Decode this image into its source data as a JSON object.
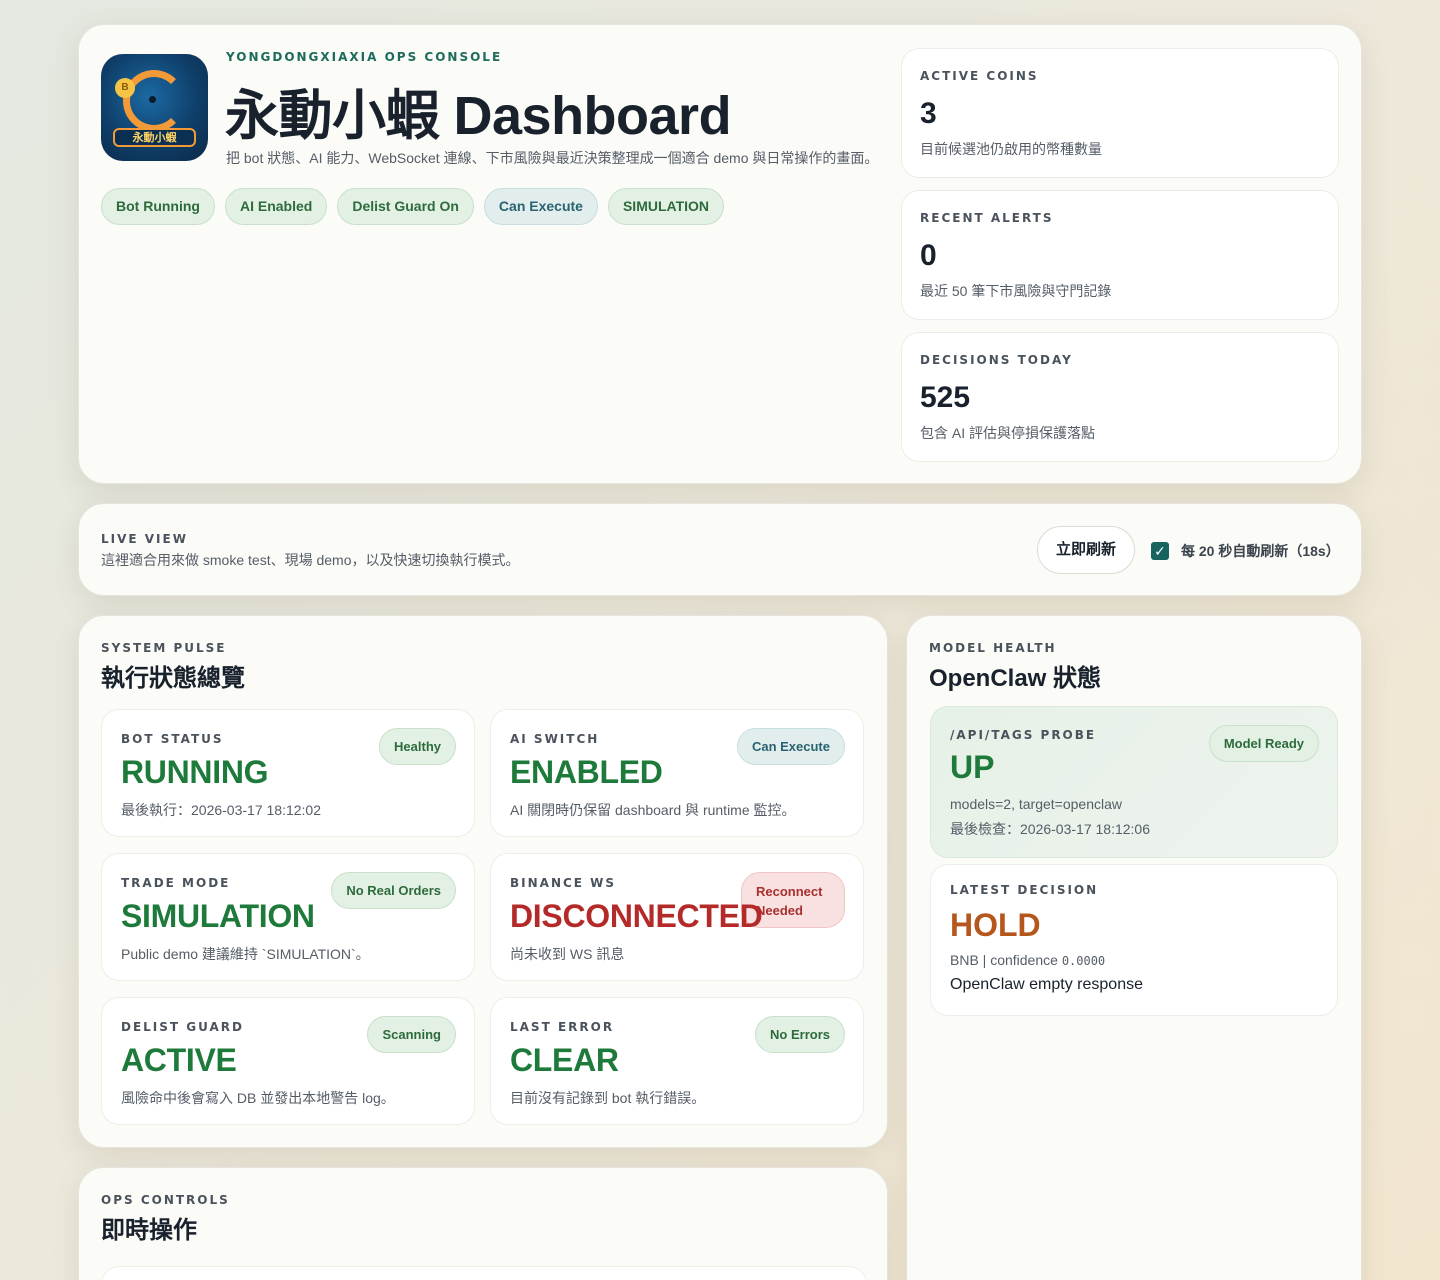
{
  "hero": {
    "eyebrow": "YONGDONGXIAXIA OPS CONSOLE",
    "title": "永動小蝦 Dashboard",
    "description": "把 bot 狀態、AI 能力、WebSocket 連線、下市風險與最近決策整理成一個適合 demo 與日常操作的畫面。",
    "logo_text": "永動小蝦",
    "logo_coin": "B",
    "chips": [
      "Bot Running",
      "AI Enabled",
      "Delist Guard On",
      "Can Execute",
      "SIMULATION"
    ],
    "stats": [
      {
        "label": "ACTIVE COINS",
        "value": "3",
        "note": "目前候選池仍啟用的幣種數量"
      },
      {
        "label": "RECENT ALERTS",
        "value": "0",
        "note": "最近 50 筆下市風險與守門記錄"
      },
      {
        "label": "DECISIONS TODAY",
        "value": "525",
        "note": "包含 AI 評估與停損保護落點"
      }
    ]
  },
  "live": {
    "eyebrow": "LIVE VIEW",
    "description": "這裡適合用來做 smoke test、現場 demo，以及快速切換執行模式。",
    "refresh_label": "立即刷新",
    "auto_refresh_label": "每 20 秒自動刷新（18s）",
    "auto_refresh_checked": true
  },
  "pulse": {
    "eyebrow": "SYSTEM PULSE",
    "title": "執行狀態總覽",
    "tiles": [
      {
        "label": "BOT STATUS",
        "badge": "Healthy",
        "value": "RUNNING",
        "note": "最後執行：2026-03-17 18:12:02"
      },
      {
        "label": "AI SWITCH",
        "badge": "Can Execute",
        "value": "ENABLED",
        "note": "AI 關閉時仍保留 dashboard 與 runtime 監控。"
      },
      {
        "label": "TRADE MODE",
        "badge": "No Real Orders",
        "value": "SIMULATION",
        "note": "Public demo 建議維持 `SIMULATION`。"
      },
      {
        "label": "BINANCE WS",
        "badge": "Reconnect Needed",
        "value": "DISCONNECTED",
        "note": "尚未收到 WS 訊息"
      },
      {
        "label": "DELIST GUARD",
        "badge": "Scanning",
        "value": "ACTIVE",
        "note": "風險命中後會寫入 DB 並發出本地警告 log。"
      },
      {
        "label": "LAST ERROR",
        "badge": "No Errors",
        "value": "CLEAR",
        "note": "目前沒有記錄到 bot 執行錯誤。"
      }
    ]
  },
  "model": {
    "eyebrow": "MODEL HEALTH",
    "title": "OpenClaw 狀態",
    "probe": {
      "label": "/API/TAGS PROBE",
      "badge": "Model Ready",
      "value": "UP",
      "line1": "models=2, target=openclaw",
      "line2": "最後檢查：2026-03-17 18:12:06"
    },
    "decision": {
      "label": "LATEST DECISION",
      "value": "HOLD",
      "coin": "BNB | confidence ",
      "confidence": "0.0000",
      "reason": "OpenClaw empty response"
    }
  },
  "ops": {
    "eyebrow": "OPS CONTROLS",
    "title": "即時操作"
  },
  "colors": {
    "accent": "#17635e",
    "ok_green": "#1e7a3a",
    "error_red": "#b32a28",
    "hold_orange": "#b5561c"
  }
}
